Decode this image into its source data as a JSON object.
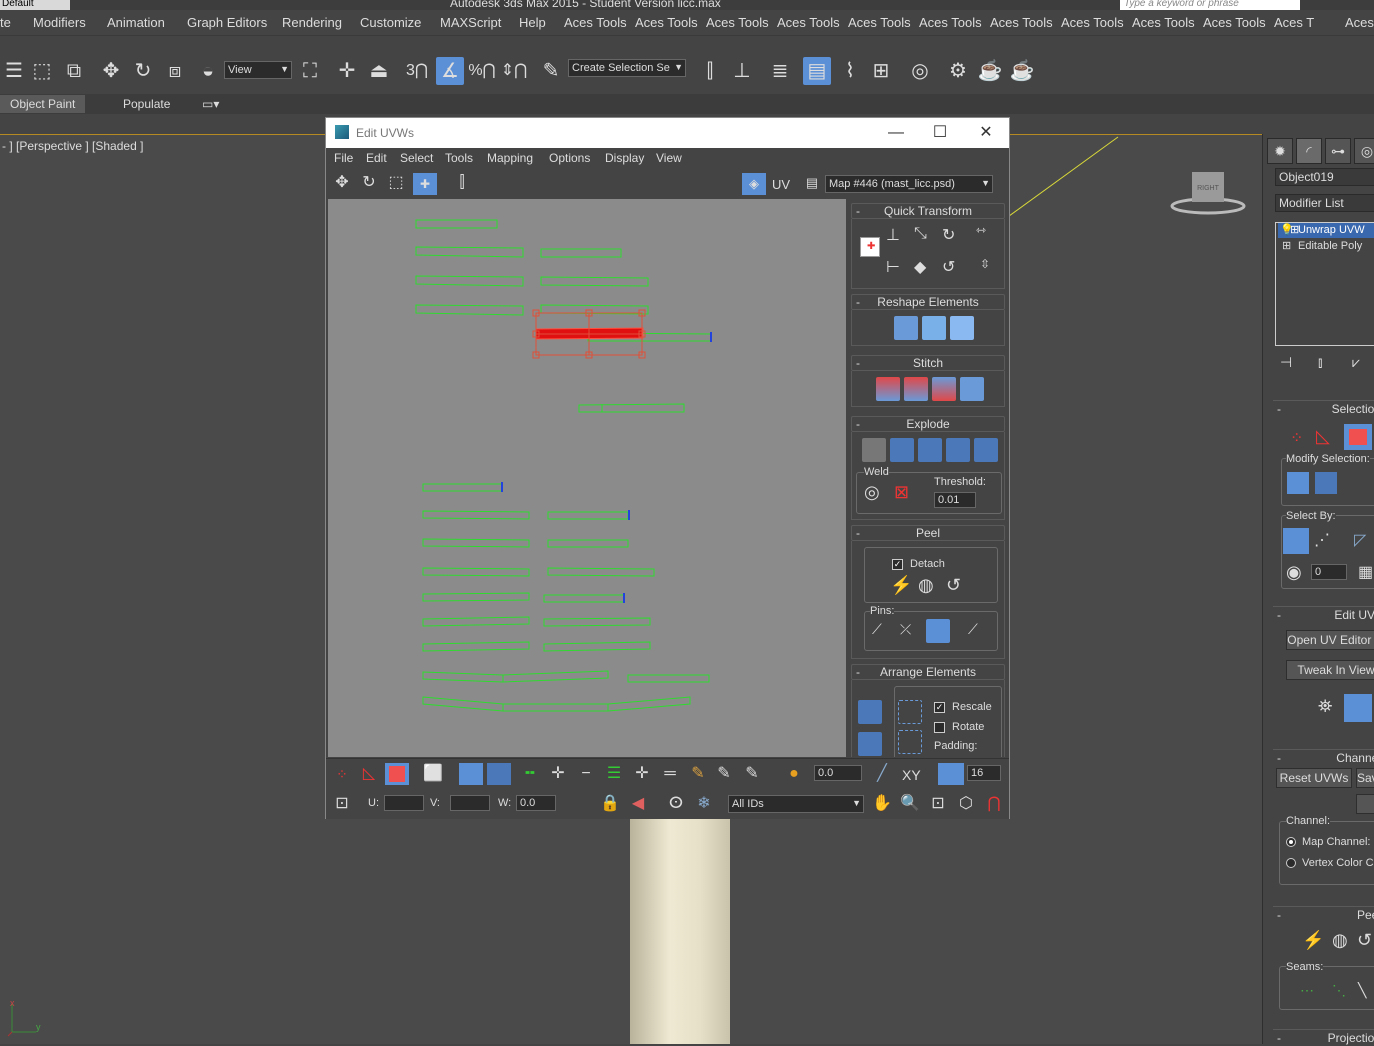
{
  "window": {
    "workspace": "Default",
    "app_title": "Autodesk 3ds Max 2015 - Student Version   licc.max",
    "search_placeholder": "Type a keyword or phrase"
  },
  "menubar": {
    "items": [
      "te",
      "Modifiers",
      "Animation",
      "Graph Editors",
      "Rendering",
      "Customize",
      "MAXScript",
      "Help",
      "Aces Tools",
      "Aces Tools",
      "Aces Tools",
      "Aces Tools",
      "Aces Tools",
      "Aces Tools",
      "Aces Tools",
      "Aces Tools",
      "Aces Tools",
      "Aces Tools",
      "Aces T"
    ]
  },
  "toolbar": {
    "ref_coord": "View",
    "selection_set": "Create Selection Se",
    "snap_3": "3",
    "percent_snap": "%"
  },
  "ribbon": {
    "tabs": [
      "Object Paint",
      "Populate"
    ]
  },
  "viewport": {
    "label": "- ] [Perspective ] [Shaded ]",
    "navcube_label": "RIGHT",
    "axis_x": "x",
    "axis_y": "y"
  },
  "command_panel": {
    "object_name": "Object019",
    "modifier_list": "Modifier List",
    "stack": [
      "Unwrap UVW",
      "Editable Poly"
    ],
    "selection": {
      "title": "Selection",
      "modify_selection": "Modify Selection:",
      "select_by": "Select By:",
      "spinner_value": "0"
    },
    "edit_uvs": {
      "title": "Edit UVs",
      "open_uv_editor": "Open UV Editor ...",
      "tweak": "Tweak In View"
    },
    "channel": {
      "title": "Channel",
      "reset_uvws": "Reset UVWs",
      "save": "Save...",
      "channel_label": "Channel:",
      "map_channel": "Map Channel:",
      "vertex_color": "Vertex Color Channel"
    },
    "peel": {
      "title": "Peel",
      "seams": "Seams:"
    },
    "projection": {
      "title": "Projection"
    }
  },
  "uv_editor": {
    "title": "Edit UVWs",
    "menu": [
      "File",
      "Edit",
      "Select",
      "Tools",
      "Mapping",
      "Options",
      "Display",
      "View"
    ],
    "uv_label": "UV",
    "map_dropdown": "Map #446 (mast_licc.psd)",
    "panels": {
      "quick_transform": "Quick Transform",
      "reshape_elements": "Reshape Elements",
      "stitch": "Stitch",
      "explode": "Explode",
      "weld": "Weld",
      "threshold_label": "Threshold:",
      "threshold_value": "0.01",
      "peel": "Peel",
      "detach": "Detach",
      "pins": "Pins:",
      "arrange_elements": "Arrange Elements",
      "rescale": "Rescale",
      "rotate": "Rotate",
      "padding": "Padding:"
    },
    "bottom": {
      "soft_value": "0.0",
      "xy_label": "XY",
      "grid_value": "16",
      "u_label": "U:",
      "v_label": "V:",
      "w_label": "W:",
      "w_value": "0.0",
      "ids_dropdown": "All IDs"
    },
    "colors": {
      "canvas": "#8b8b8b",
      "uv_edge": "#2edc2e",
      "selected": "#e01010",
      "accent": "#5b8fd6"
    }
  }
}
